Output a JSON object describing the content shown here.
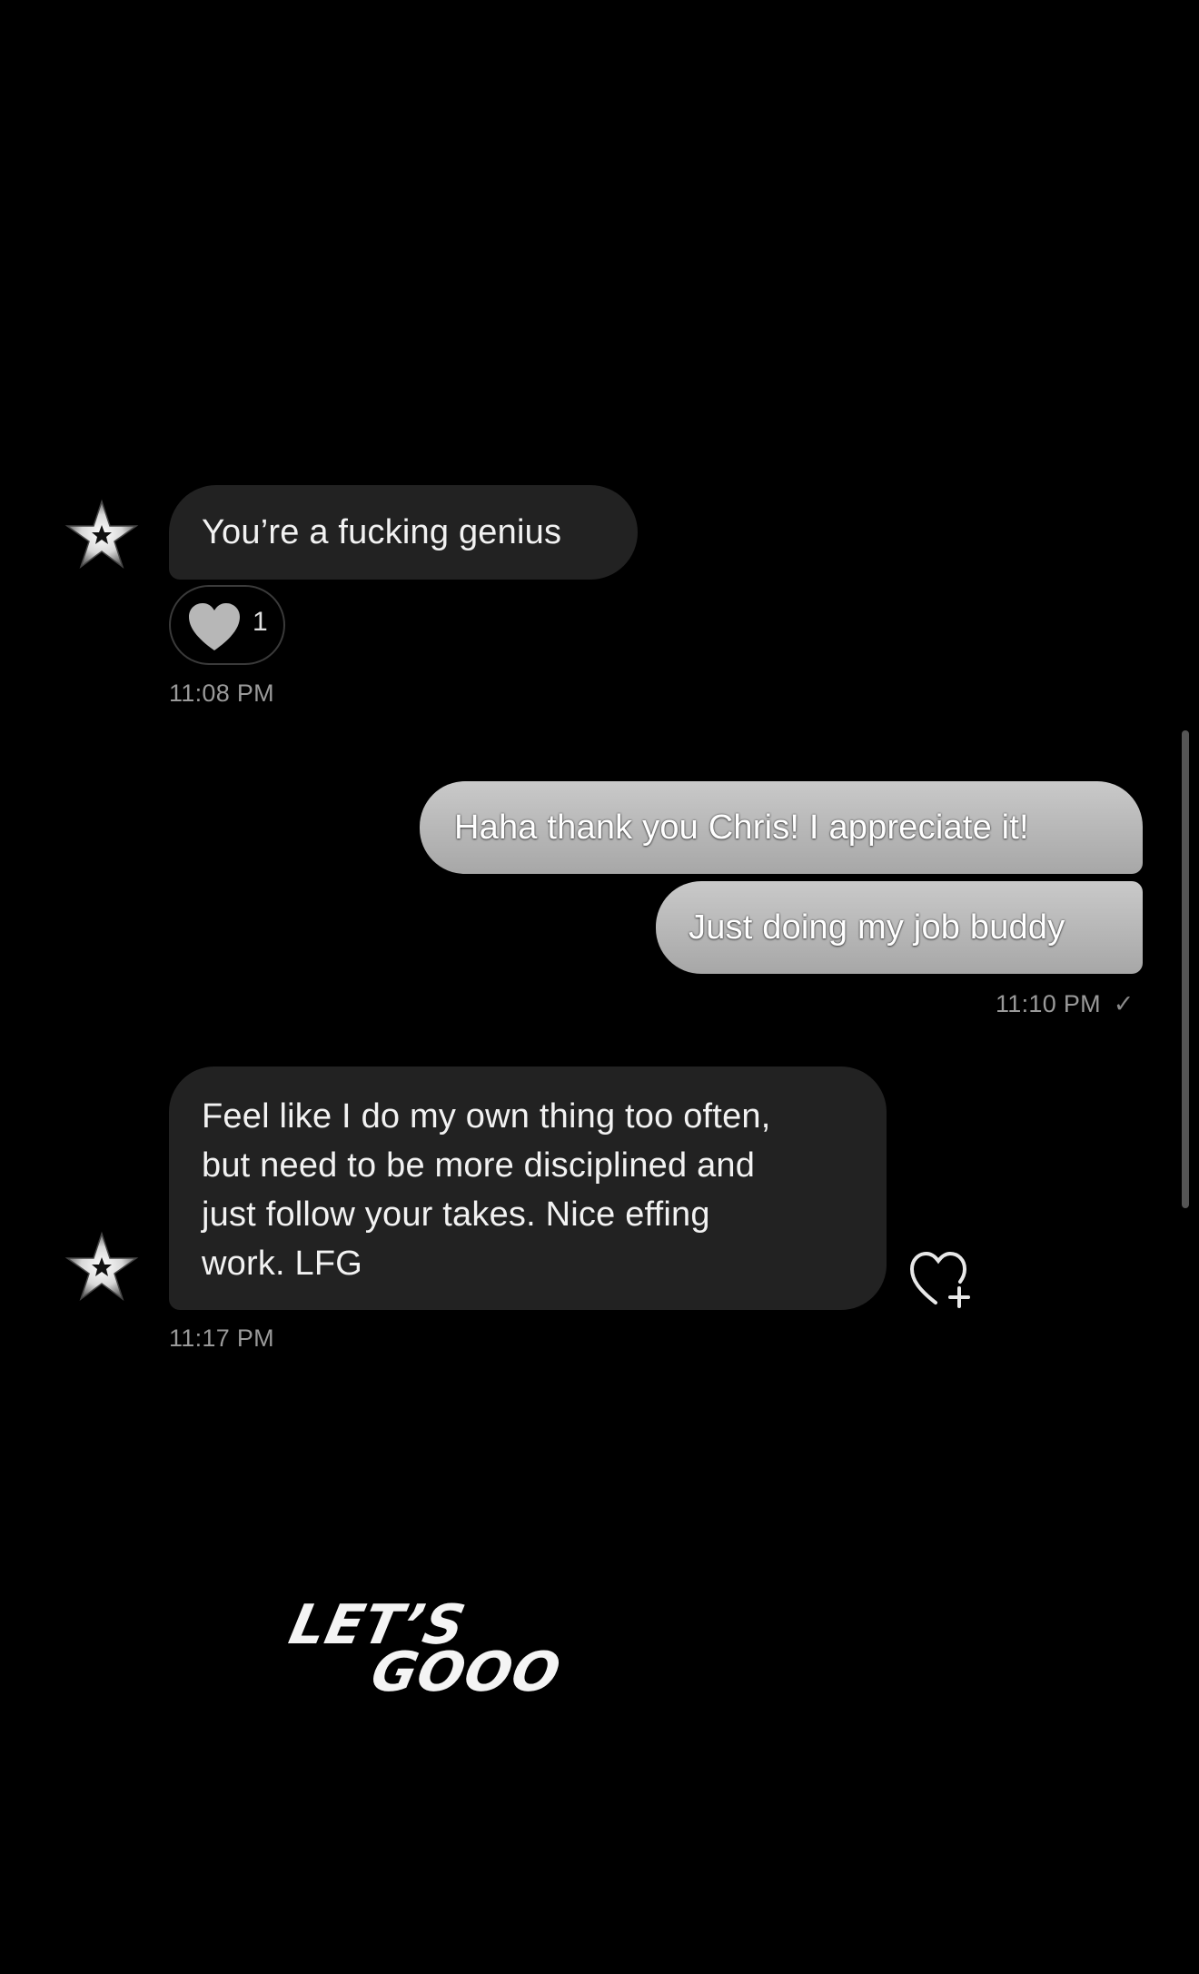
{
  "messages": [
    {
      "direction": "incoming",
      "text": "You’re a fucking genius",
      "reaction": {
        "icon": "heart-icon",
        "count": "1"
      },
      "time": "11:08 PM"
    },
    {
      "direction": "outgoing",
      "text": "Haha thank you Chris! I appreciate it!"
    },
    {
      "direction": "outgoing",
      "text": "Just doing my job buddy",
      "time": "11:10 PM",
      "status_icon": "check-icon"
    },
    {
      "direction": "incoming",
      "lines": [
        "Feel like I do my own thing too often,",
        "but need to be more disciplined and",
        "just follow your takes.  Nice effing",
        "work.  LFG"
      ],
      "time": "11:17 PM"
    }
  ],
  "sticker": {
    "line1": "LET’S",
    "line2": "GOOO"
  },
  "icons": {
    "avatar": "star-avatar-icon",
    "add_reaction": "heart-plus-icon"
  },
  "colors": {
    "background": "#000000",
    "incoming_bubble": "#222222",
    "outgoing_bubble": "#b8b8b8",
    "timestamp": "#9a9a9a"
  }
}
